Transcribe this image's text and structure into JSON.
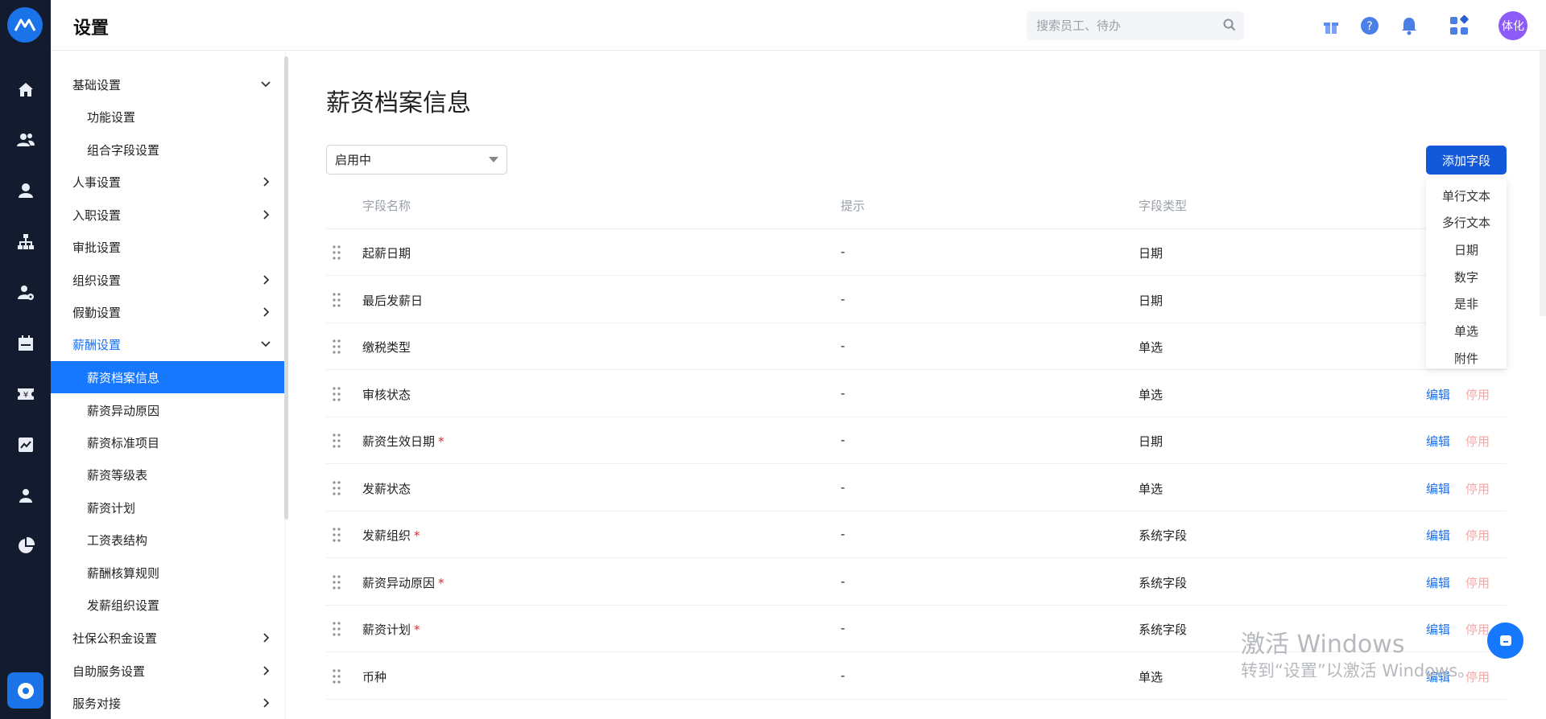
{
  "header": {
    "title": "设置",
    "search_placeholder": "搜索员工、待办",
    "avatar_text": "体化"
  },
  "rail": {
    "icons": [
      "home-icon",
      "users-icon",
      "person-icon",
      "org-chart-icon",
      "person-settings-icon",
      "calendar-icon",
      "salary-icon",
      "report-icon",
      "profile-icon",
      "pie-chart-icon"
    ],
    "bottom_icon": "settings-icon"
  },
  "sidebar": {
    "items": [
      {
        "label": "基础设置",
        "level": 1,
        "chevron": "down"
      },
      {
        "label": "功能设置",
        "level": 2
      },
      {
        "label": "组合字段设置",
        "level": 2
      },
      {
        "label": "人事设置",
        "level": 1,
        "chevron": "right"
      },
      {
        "label": "入职设置",
        "level": 1,
        "chevron": "right"
      },
      {
        "label": "审批设置",
        "level": 1
      },
      {
        "label": "组织设置",
        "level": 1,
        "chevron": "right"
      },
      {
        "label": "假勤设置",
        "level": 1,
        "chevron": "right"
      },
      {
        "label": "薪酬设置",
        "level": 1,
        "chevron": "down",
        "active": true
      },
      {
        "label": "薪资档案信息",
        "level": 2,
        "selected": true
      },
      {
        "label": "薪资异动原因",
        "level": 2
      },
      {
        "label": "薪资标准项目",
        "level": 2
      },
      {
        "label": "薪资等级表",
        "level": 2
      },
      {
        "label": "薪资计划",
        "level": 2
      },
      {
        "label": "工资表结构",
        "level": 2
      },
      {
        "label": "薪酬核算规则",
        "level": 2
      },
      {
        "label": "发薪组织设置",
        "level": 2
      },
      {
        "label": "社保公积金设置",
        "level": 1,
        "chevron": "right"
      },
      {
        "label": "自助服务设置",
        "level": 1,
        "chevron": "right"
      },
      {
        "label": "服务对接",
        "level": 1,
        "chevron": "right"
      }
    ]
  },
  "main": {
    "title": "薪资档案信息",
    "status_filter": "启用中",
    "add_button": "添加字段",
    "columns": [
      "字段名称",
      "提示",
      "字段类型"
    ],
    "rows": [
      {
        "name": "起薪日期",
        "required": false,
        "hint": "-",
        "type": "日期",
        "actions": false
      },
      {
        "name": "最后发薪日",
        "required": false,
        "hint": "-",
        "type": "日期",
        "actions": false
      },
      {
        "name": "缴税类型",
        "required": false,
        "hint": "-",
        "type": "单选",
        "actions": false
      },
      {
        "name": "审核状态",
        "required": false,
        "hint": "-",
        "type": "单选",
        "actions": true
      },
      {
        "name": "薪资生效日期",
        "required": true,
        "hint": "-",
        "type": "日期",
        "actions": true
      },
      {
        "name": "发薪状态",
        "required": false,
        "hint": "-",
        "type": "单选",
        "actions": true
      },
      {
        "name": "发薪组织",
        "required": true,
        "hint": "-",
        "type": "系统字段",
        "actions": true
      },
      {
        "name": "薪资异动原因",
        "required": true,
        "hint": "-",
        "type": "系统字段",
        "actions": true
      },
      {
        "name": "薪资计划",
        "required": true,
        "hint": "-",
        "type": "系统字段",
        "actions": true
      },
      {
        "name": "币种",
        "required": false,
        "hint": "-",
        "type": "单选",
        "actions": true
      }
    ],
    "edit_label": "编辑",
    "disable_label": "停用",
    "required_mark": "*"
  },
  "add_menu": {
    "items": [
      "单行文本",
      "多行文本",
      "日期",
      "数字",
      "是非",
      "单选",
      "附件"
    ]
  },
  "windows_watermark": {
    "line1": "激活 Windows",
    "line2": "转到“设置”以激活 Windows。"
  },
  "colors": {
    "rail_bg": "#131b2e",
    "accent": "#1677ff",
    "primary_button": "#1258d9",
    "link": "#1f6fe8",
    "disabled_link": "#f5a7a7",
    "required": "#f5222d"
  }
}
